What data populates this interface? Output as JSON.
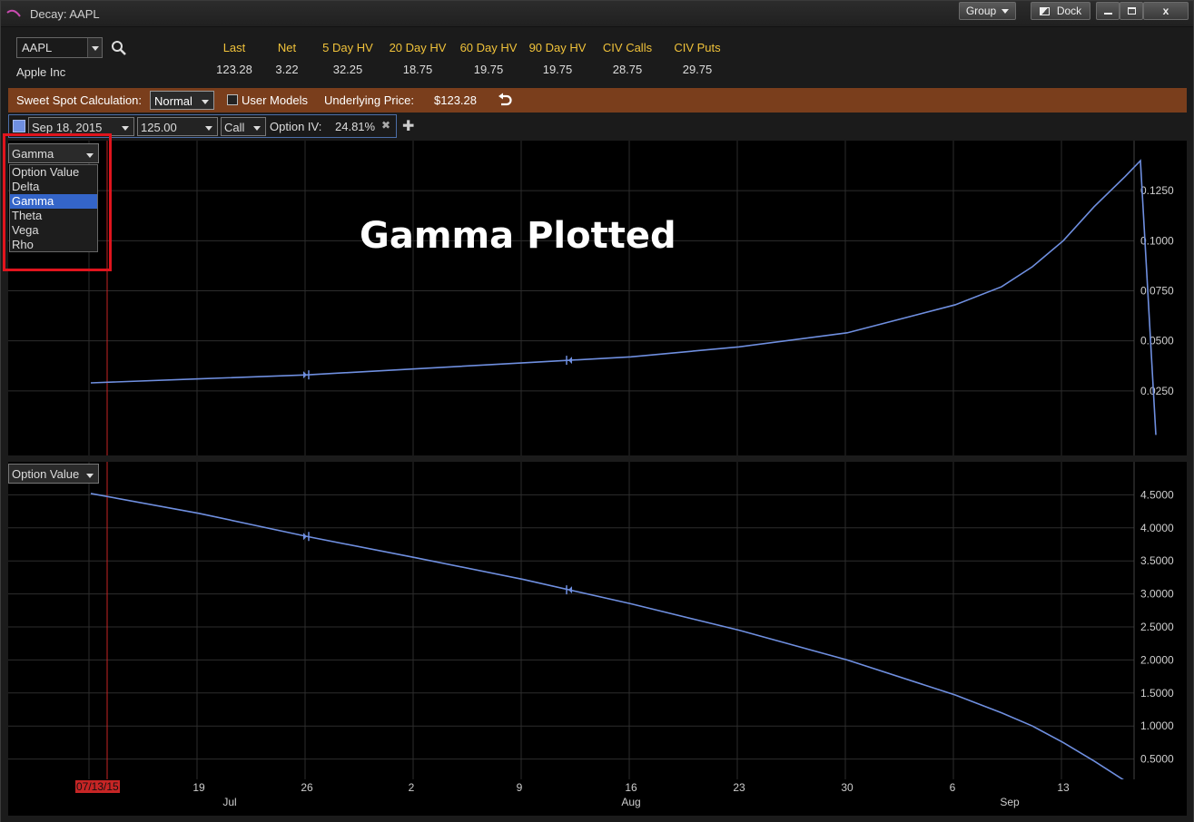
{
  "window": {
    "title": "Decay: AAPL",
    "group_label": "Group",
    "dock_label": "Dock",
    "close_label": "x"
  },
  "header": {
    "symbol": "AAPL",
    "company": "Apple Inc",
    "quote_headers": [
      "Last",
      "Net",
      "5 Day HV",
      "20 Day HV",
      "60 Day HV",
      "90 Day HV",
      "CIV Calls",
      "CIV Puts"
    ],
    "quote_values": [
      "123.28",
      "3.22",
      "32.25",
      "18.75",
      "19.75",
      "19.75",
      "28.75",
      "29.75"
    ]
  },
  "calc_bar": {
    "label": "Sweet Spot Calculation:",
    "mode": "Normal",
    "user_models_label": "User Models",
    "user_models_checked": false,
    "underlying_label": "Underlying Price:",
    "underlying_value": "$123.28"
  },
  "option_row": {
    "expiration": "Sep 18, 2015",
    "strike": "125.00",
    "type": "Call",
    "iv_label": "Option IV:",
    "iv_value": "24.81%",
    "remove_label": "✖",
    "add_label": "✚",
    "series_color": "#6f8fe0"
  },
  "top_chart": {
    "selected_metric": "Gamma",
    "metric_options": [
      "Option Value",
      "Delta",
      "Gamma",
      "Theta",
      "Vega",
      "Rho"
    ],
    "annotation": "Gamma Plotted",
    "y_ticks": [
      "0.1250",
      "0.1000",
      "0.0750",
      "0.0500",
      "0.0250"
    ]
  },
  "bottom_chart": {
    "selected_metric": "Option Value",
    "y_ticks": [
      "4.5000",
      "4.0000",
      "3.5000",
      "3.0000",
      "2.5000",
      "2.0000",
      "1.5000",
      "1.0000",
      "0.5000"
    ]
  },
  "x_axis": {
    "today_label": "07/13/15",
    "day_ticks": [
      "19",
      "26",
      "2",
      "9",
      "16",
      "23",
      "30",
      "6",
      "13"
    ],
    "month_labels": [
      "Jul",
      "Aug",
      "Sep"
    ]
  },
  "chart_data": [
    {
      "type": "line",
      "title": "",
      "ylabel": "",
      "xlabel": "",
      "ylim": [
        0,
        0.15
      ],
      "x": [
        "07/12/15",
        "07/19/15",
        "07/26/15",
        "08/02/15",
        "08/09/15",
        "08/16/15",
        "08/23/15",
        "08/30/15",
        "09/06/15",
        "09/09/15",
        "09/11/15",
        "09/13/15",
        "09/15/15",
        "09/17/15",
        "09/18/15",
        "09/19/15"
      ],
      "series": [
        {
          "values": [
            0.029,
            0.031,
            0.033,
            0.036,
            0.039,
            0.042,
            0.047,
            0.054,
            0.068,
            0.077,
            0.087,
            0.1,
            0.117,
            0.132,
            0.14,
            0.003
          ]
        }
      ],
      "marker_dates": [
        "07/26/15",
        "08/12/15"
      ],
      "grid": true,
      "axis_side": "right"
    },
    {
      "type": "line",
      "title": "",
      "ylabel": "",
      "xlabel": "",
      "ylim": [
        0,
        5.0
      ],
      "x": [
        "07/12/15",
        "07/19/15",
        "07/26/15",
        "08/02/15",
        "08/09/15",
        "08/16/15",
        "08/23/15",
        "08/30/15",
        "09/06/15",
        "09/09/15",
        "09/11/15",
        "09/13/15",
        "09/15/15",
        "09/17/15",
        "09/18/15"
      ],
      "series": [
        {
          "values": [
            4.52,
            4.22,
            3.87,
            3.55,
            3.22,
            2.85,
            2.45,
            2.0,
            1.47,
            1.2,
            1.0,
            0.75,
            0.47,
            0.17,
            0.06
          ]
        }
      ],
      "marker_dates": [
        "07/26/15",
        "08/12/15"
      ],
      "grid": true,
      "axis_side": "right"
    }
  ]
}
